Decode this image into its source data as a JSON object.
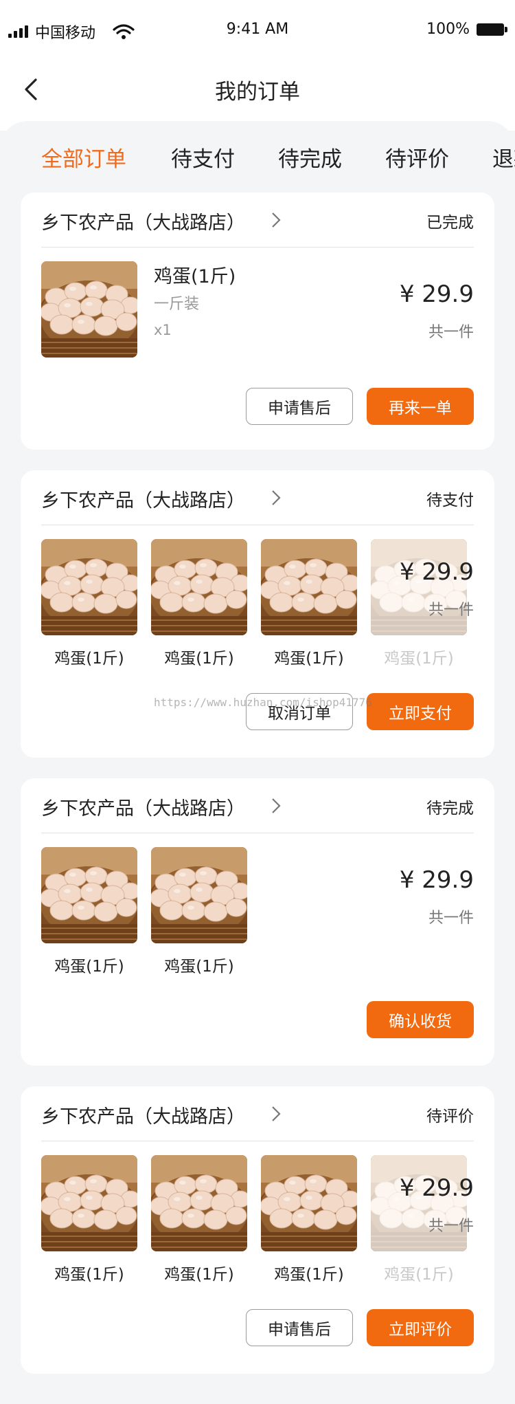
{
  "status_bar": {
    "carrier": "中国移动",
    "time": "9:41 AM",
    "battery": "100%"
  },
  "nav": {
    "title": "我的订单"
  },
  "tabs": [
    "全部订单",
    "待支付",
    "待完成",
    "待评价",
    "退款"
  ],
  "active_tab_color": "#f26a1b",
  "accent_color": "#f26a10",
  "orders": [
    {
      "shop": "乡下农产品（大战路店）",
      "status": "已完成",
      "item": {
        "name": "鸡蛋(1斤)",
        "spec": "一斤装",
        "qty": "x1"
      },
      "price": "¥ 29.9",
      "count": "共一件",
      "buttons": [
        "申请售后",
        "再来一单"
      ]
    },
    {
      "shop": "乡下农产品（大战路店）",
      "status": "待支付",
      "items": [
        "鸡蛋(1斤)",
        "鸡蛋(1斤)",
        "鸡蛋(1斤)",
        "鸡蛋(1斤)"
      ],
      "price": "¥ 29.9",
      "count": "共一件",
      "buttons": [
        "取消订单",
        "立即支付"
      ]
    },
    {
      "shop": "乡下农产品（大战路店）",
      "status": "待完成",
      "items": [
        "鸡蛋(1斤)",
        "鸡蛋(1斤)"
      ],
      "price": "¥ 29.9",
      "count": "共一件",
      "buttons": [
        "确认收货"
      ]
    },
    {
      "shop": "乡下农产品（大战路店）",
      "status": "待评价",
      "items": [
        "鸡蛋(1斤)",
        "鸡蛋(1斤)",
        "鸡蛋(1斤)",
        "鸡蛋(1斤)"
      ],
      "price": "¥ 29.9",
      "count": "共一件",
      "buttons": [
        "申请售后",
        "立即评价"
      ]
    }
  ],
  "watermark": "https://www.huzhan.com/ishop41776"
}
